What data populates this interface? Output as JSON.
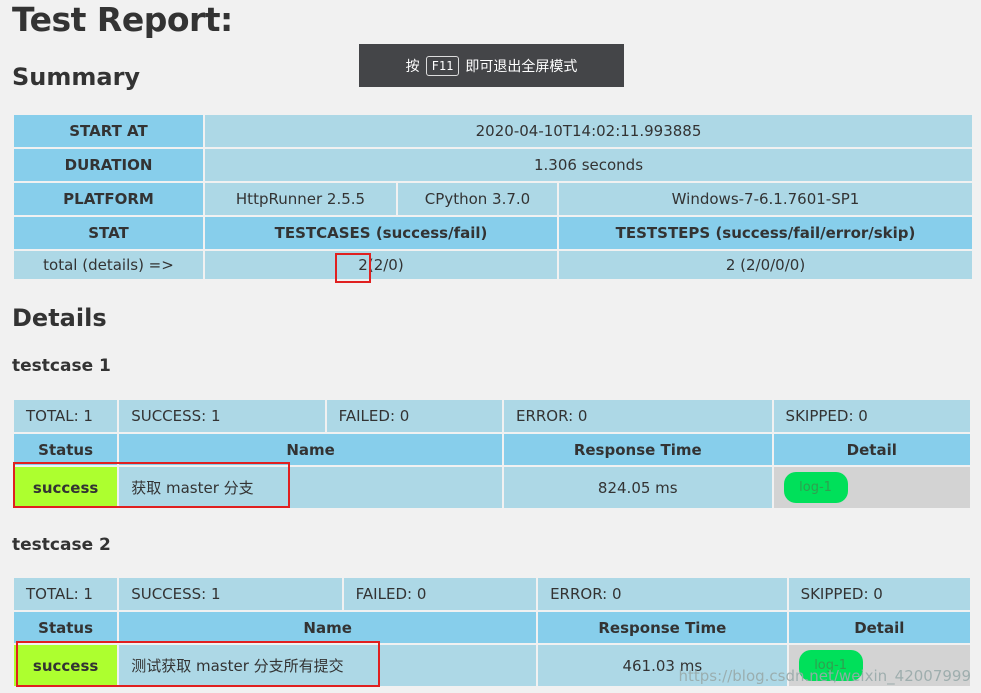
{
  "title": "Test Report:",
  "toast": {
    "pre": "按",
    "key": "F11",
    "post": "即可退出全屏模式"
  },
  "summary": {
    "heading": "Summary",
    "start_at_label": "START AT",
    "start_at": "2020-04-10T14:02:11.993885",
    "duration_label": "DURATION",
    "duration": "1.306 seconds",
    "platform_label": "PLATFORM",
    "platform_runner": "HttpRunner 2.5.5",
    "platform_python": "CPython 3.7.0",
    "platform_os": "Windows-7-6.1.7601-SP1",
    "stat_label": "STAT",
    "testcases_header": "TESTCASES (success/fail)",
    "teststeps_header": "TESTSTEPS (success/fail/error/skip)",
    "total_label": "total (details) =>",
    "testcases_total": "2",
    "testcases_breakdown": "(2/0)",
    "teststeps_value": "2 (2/0/0/0)"
  },
  "details": {
    "heading": "Details",
    "columns": {
      "status": "Status",
      "name": "Name",
      "response_time": "Response Time",
      "detail": "Detail"
    },
    "testcases": [
      {
        "title": "testcase 1",
        "total": "TOTAL: 1",
        "success": "SUCCESS: 1",
        "failed": "FAILED: 0",
        "error": "ERROR: 0",
        "skipped": "SKIPPED: 0",
        "row": {
          "status": "success",
          "name": "获取 master 分支",
          "response_time": "824.05 ms",
          "log": "log-1"
        }
      },
      {
        "title": "testcase 2",
        "total": "TOTAL: 1",
        "success": "SUCCESS: 1",
        "failed": "FAILED: 0",
        "error": "ERROR: 0",
        "skipped": "SKIPPED: 0",
        "row": {
          "status": "success",
          "name": "测试获取 master 分支所有提交",
          "response_time": "461.03 ms",
          "log": "log-1"
        }
      }
    ]
  },
  "watermark": "https://blog.csdn.net/weixin_42007999",
  "colors": {
    "header": "#87ceeb",
    "cell": "#add8e6",
    "success": "#adff2f",
    "log_button": "#00e05a",
    "highlight": "#e02020"
  }
}
